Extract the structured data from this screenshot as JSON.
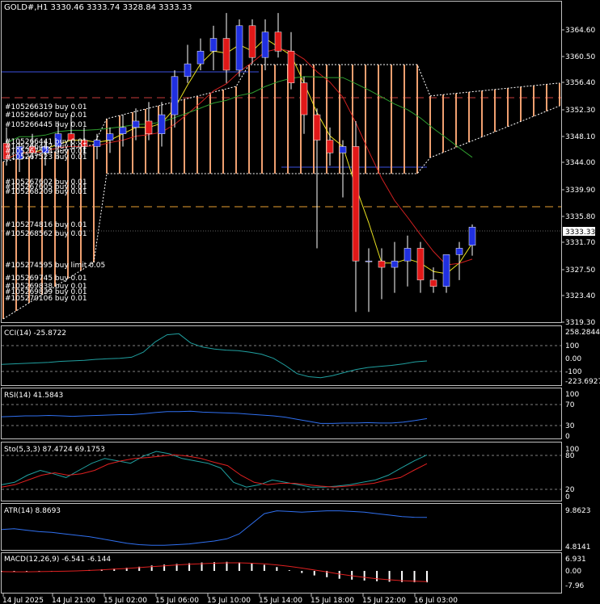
{
  "main": {
    "header": "GOLD#,H1  3330.46 3333.74 3328.84 3333.33",
    "current_price": "3333.33",
    "y_ticks": [
      "3364.60",
      "3360.50",
      "3356.40",
      "3352.30",
      "3348.10",
      "3344.00",
      "3339.90",
      "3335.80",
      "3331.70",
      "3327.50",
      "3323.40",
      "3319.30"
    ],
    "order_labels": [
      "#105266319 buy 0.01",
      "#105266407 buy 0.01",
      "#105266445 buy 0.01",
      "#105266441 buy 0.01",
      "#105266442 buy 0.01",
      "#105267524 buy 0.01",
      "#105267523 buy 0.01",
      "#105267602 buy 0.01",
      "#105267605 buy 0.01",
      "#105268209 buy 0.01",
      "#105274816 buy 0.01",
      "#105268562 buy 0.01",
      "#105274595 buy limit 0.05",
      "#105269745 buy 0.01",
      "#105269838 buy 0.01",
      "#105269839 buy 0.01",
      "#105270106 buy 0.01"
    ]
  },
  "indicators": {
    "cci": {
      "label": "CCI(14) -25.8722",
      "ticks": [
        "258.2844",
        "100",
        "0.00",
        "-100",
        "-223.6927"
      ]
    },
    "rsi": {
      "label": "RSI(14) 41.5843",
      "ticks": [
        "100",
        "70",
        "30",
        "0"
      ]
    },
    "sto": {
      "label": "Sto(5,3,3) 87.4724 69.1753",
      "ticks": [
        "100",
        "80",
        "20",
        "0"
      ]
    },
    "atr": {
      "label": "ATR(14) 8.8693",
      "ticks": [
        "9.8623",
        "4.8141"
      ]
    },
    "macd": {
      "label": "MACD(12,26,9) -6.541 -6.144",
      "ticks": [
        "6.931",
        "0.00",
        "-7.96"
      ]
    }
  },
  "time_axis": [
    "14 Jul 2025",
    "14 Jul 21:00",
    "15 Jul 02:00",
    "15 Jul 06:00",
    "15 Jul 10:00",
    "15 Jul 14:00",
    "15 Jul 18:00",
    "15 Jul 22:00",
    "16 Jul 03:00"
  ],
  "chart_data": {
    "type": "candlestick",
    "symbol": "GOLD#",
    "timeframe": "H1",
    "ohlc": [
      [
        3346.5,
        3349,
        3343,
        3344
      ],
      [
        3344,
        3347,
        3342,
        3346
      ],
      [
        3346,
        3348,
        3344,
        3345
      ],
      [
        3345,
        3347,
        3343,
        3346
      ],
      [
        3346,
        3350,
        3344,
        3348
      ],
      [
        3348,
        3351,
        3346,
        3347
      ],
      [
        3347,
        3349,
        3345,
        3346
      ],
      [
        3346,
        3348,
        3344,
        3347
      ],
      [
        3347,
        3349,
        3345,
        3348
      ],
      [
        3348,
        3351,
        3346,
        3349
      ],
      [
        3349,
        3352,
        3347,
        3350
      ],
      [
        3350,
        3353,
        3347,
        3348
      ],
      [
        3348,
        3353,
        3346,
        3351
      ],
      [
        3351,
        3358,
        3349,
        3357
      ],
      [
        3357,
        3362,
        3356,
        3359
      ],
      [
        3359,
        3363,
        3358,
        3361
      ],
      [
        3361,
        3365,
        3358,
        3363
      ],
      [
        3363,
        3367,
        3356,
        3358
      ],
      [
        3358,
        3366,
        3357,
        3365
      ],
      [
        3365,
        3366,
        3359,
        3360
      ],
      [
        3360,
        3366,
        3358,
        3364
      ],
      [
        3364,
        3367,
        3360,
        3361
      ],
      [
        3361,
        3364,
        3355,
        3356
      ],
      [
        3356,
        3357,
        3348,
        3351
      ],
      [
        3351,
        3352,
        3330,
        3347
      ],
      [
        3347,
        3349,
        3343,
        3345
      ],
      [
        3345,
        3347,
        3338,
        3346
      ],
      [
        3346,
        3350,
        3320,
        3328
      ],
      [
        3328,
        3330,
        3320,
        3328
      ],
      [
        3328,
        3330,
        3322,
        3327
      ],
      [
        3327,
        3331,
        3323,
        3328
      ],
      [
        3328,
        3332,
        3324,
        3330
      ],
      [
        3330,
        3331,
        3323,
        3325
      ],
      [
        3325,
        3327,
        3323,
        3324
      ],
      [
        3324,
        3329,
        3323,
        3329
      ],
      [
        3329,
        3331,
        3325,
        3330
      ],
      [
        3330.46,
        3333.74,
        3328.84,
        3333.33
      ]
    ],
    "cci": [
      -60,
      -55,
      -50,
      -45,
      -40,
      -30,
      -25,
      -20,
      -10,
      -5,
      0,
      10,
      60,
      160,
      230,
      240,
      150,
      110,
      90,
      80,
      75,
      60,
      40,
      0,
      -70,
      -150,
      -180,
      -190,
      -170,
      -140,
      -110,
      -90,
      -80,
      -70,
      -55,
      -35,
      -26
    ],
    "rsi": [
      46,
      47,
      48,
      48,
      49,
      48,
      47,
      48,
      49,
      50,
      51,
      51,
      53,
      56,
      58,
      58,
      59,
      57,
      56,
      55,
      54,
      52,
      50,
      48,
      45,
      40,
      35,
      30,
      30,
      31,
      31,
      32,
      31,
      31,
      33,
      37,
      41.6
    ],
    "sto_k": [
      25,
      30,
      45,
      55,
      48,
      40,
      55,
      70,
      80,
      75,
      70,
      85,
      95,
      90,
      80,
      75,
      70,
      60,
      30,
      20,
      25,
      35,
      30,
      25,
      20,
      20,
      22,
      25,
      30,
      35,
      45,
      60,
      75,
      87.5
    ],
    "sto_d": [
      20,
      25,
      35,
      45,
      50,
      45,
      48,
      55,
      68,
      75,
      80,
      82,
      85,
      88,
      85,
      80,
      72,
      65,
      45,
      30,
      25,
      28,
      28,
      25,
      22,
      20,
      22,
      25,
      28,
      35,
      40,
      55,
      69.2
    ],
    "atr": [
      7.2,
      7.3,
      7.1,
      6.9,
      6.8,
      6.6,
      6.4,
      6.2,
      5.9,
      5.6,
      5.3,
      5.1,
      5.0,
      5.0,
      5.1,
      5.2,
      5.4,
      5.6,
      5.9,
      6.6,
      8.0,
      9.4,
      9.8,
      9.7,
      9.6,
      9.7,
      9.8,
      9.8,
      9.7,
      9.6,
      9.4,
      9.2,
      9.0,
      8.9,
      8.87
    ],
    "macd": [
      -0.5,
      -0.6,
      -0.4,
      -0.3,
      -0.2,
      -0.1,
      0.2,
      0.5,
      0.9,
      1.3,
      1.8,
      2.4,
      3.1,
      3.6,
      4.0,
      4.4,
      4.8,
      5.0,
      5.2,
      4.9,
      4.4,
      3.5,
      2.2,
      0.4,
      -1.2,
      -2.6,
      -3.6,
      -4.5,
      -5.0,
      -5.5,
      -5.9,
      -6.2,
      -6.4,
      -6.5,
      -6.541
    ],
    "macd_signal": [
      -0.4,
      -0.5,
      -0.5,
      -0.4,
      -0.3,
      -0.2,
      0.0,
      0.3,
      0.6,
      1.0,
      1.4,
      1.9,
      2.4,
      2.9,
      3.4,
      3.8,
      4.1,
      4.4,
      4.6,
      4.6,
      4.4,
      4.0,
      3.4,
      2.6,
      1.6,
      0.5,
      -0.6,
      -1.8,
      -2.8,
      -3.7,
      -4.5,
      -5.1,
      -5.6,
      -5.9,
      -6.144
    ]
  }
}
